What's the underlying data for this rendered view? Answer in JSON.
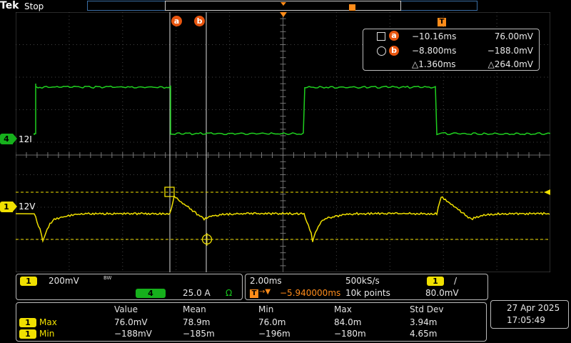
{
  "brand": "Tek",
  "acq_state": "Stop",
  "cursor_labels": [
    "a",
    "b"
  ],
  "trigger_marker_label": "T",
  "cursor_readout": {
    "a_time": "−10.16ms",
    "a_value": "76.00mV",
    "b_time": "−8.800ms",
    "b_value": "−188.0mV",
    "delta_time": "△1.360ms",
    "delta_value": "△264.0mV"
  },
  "channels": {
    "ch4": {
      "badge": "4",
      "label": "12I",
      "color": "#16c81c",
      "scale": "25.0 A",
      "unit_icon": "Ω"
    },
    "ch1": {
      "badge": "1",
      "label": "12V",
      "color": "#f0e000",
      "scale": "200mV",
      "bw_icon": "BW"
    }
  },
  "timebase": {
    "scale": "2.00ms",
    "sample_rate": "500kS/s",
    "trigger_delay": "−5.940000ms",
    "record_length": "10k points",
    "trigger_channel": "1",
    "trigger_slope": "/",
    "trigger_level": "80.0mV"
  },
  "measurements": {
    "headers": [
      "Value",
      "Mean",
      "Min",
      "Max",
      "Std Dev"
    ],
    "rows": [
      {
        "badge": "1",
        "name": "Max",
        "values": [
          "76.0mV",
          "78.9m",
          "76.0m",
          "84.0m",
          "3.94m"
        ]
      },
      {
        "badge": "1",
        "name": "Min",
        "values": [
          "−188mV",
          "−185m",
          "−196m",
          "−180m",
          "4.65m"
        ]
      }
    ]
  },
  "datetime": {
    "date": "27 Apr  2025",
    "time": "17:05:49"
  }
}
